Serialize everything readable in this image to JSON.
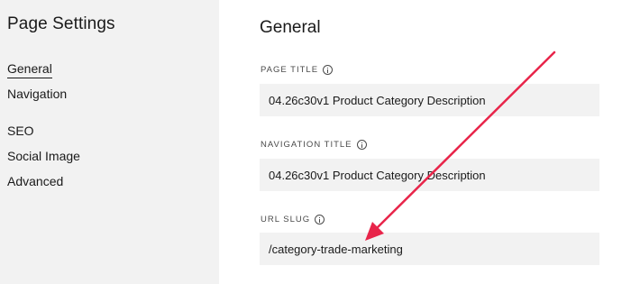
{
  "sidebar": {
    "title": "Page Settings",
    "items": [
      {
        "label": "General"
      },
      {
        "label": "Navigation"
      },
      {
        "label": "SEO"
      },
      {
        "label": "Social Image"
      },
      {
        "label": "Advanced"
      }
    ]
  },
  "main": {
    "section_title": "General",
    "fields": [
      {
        "label": "PAGE TITLE",
        "value": "04.26c30v1 Product Category Description"
      },
      {
        "label": "NAVIGATION TITLE",
        "value": "04.26c30v1 Product Category Description"
      },
      {
        "label": "URL SLUG",
        "value": "/category-trade-marketing"
      }
    ]
  },
  "annotation": {
    "arrow_color": "#e8254a"
  },
  "colors": {
    "sidebar_bg": "#f2f2f2",
    "field_bg": "#f2f2f2",
    "text": "#1a1a1a"
  }
}
